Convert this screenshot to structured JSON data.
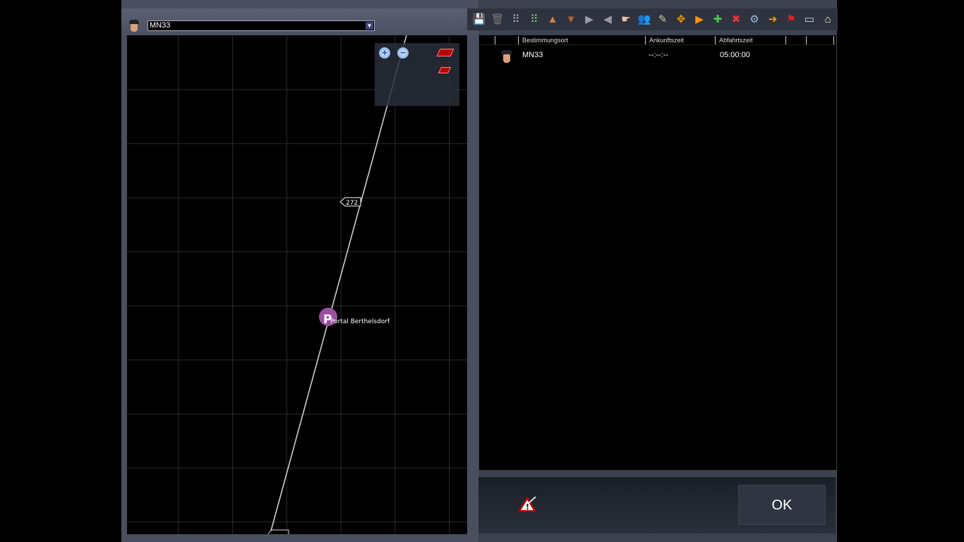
{
  "left_panel": {
    "train_select": {
      "value": "MN33"
    },
    "map": {
      "signal_label": "272",
      "station_label": "Portal Berthelsdorf",
      "station_marker": "P",
      "tools": [
        "zoom-in-icon",
        "zoom-out-icon",
        "track-segment-icon",
        "track-junction-icon"
      ]
    }
  },
  "toolbar": {
    "icons": [
      "save-icon",
      "trash-icon",
      "grid-icon",
      "grid-green-icon",
      "move-up-icon",
      "move-down-icon",
      "insert-after-icon",
      "insert-before-icon",
      "pointing-hand-icon",
      "passengers-icon",
      "driver-icon",
      "expand-icon",
      "add-next-icon",
      "add-icon",
      "remove-icon",
      "settings-icon",
      "exit-icon",
      "flag-icon",
      "panel-icon",
      "station-icon"
    ]
  },
  "table": {
    "columns": [
      "",
      "Bestimmungsort",
      "Ankunftszeit",
      "Abfahrtszeit",
      "",
      ""
    ],
    "rows": [
      {
        "destination": "MN33",
        "arrival": "--:--:--",
        "departure": "05:00:00"
      }
    ]
  },
  "footer": {
    "ok_label": "OK"
  },
  "colors": {
    "station": "#9b4fa0",
    "panel": "#4a4f60"
  }
}
